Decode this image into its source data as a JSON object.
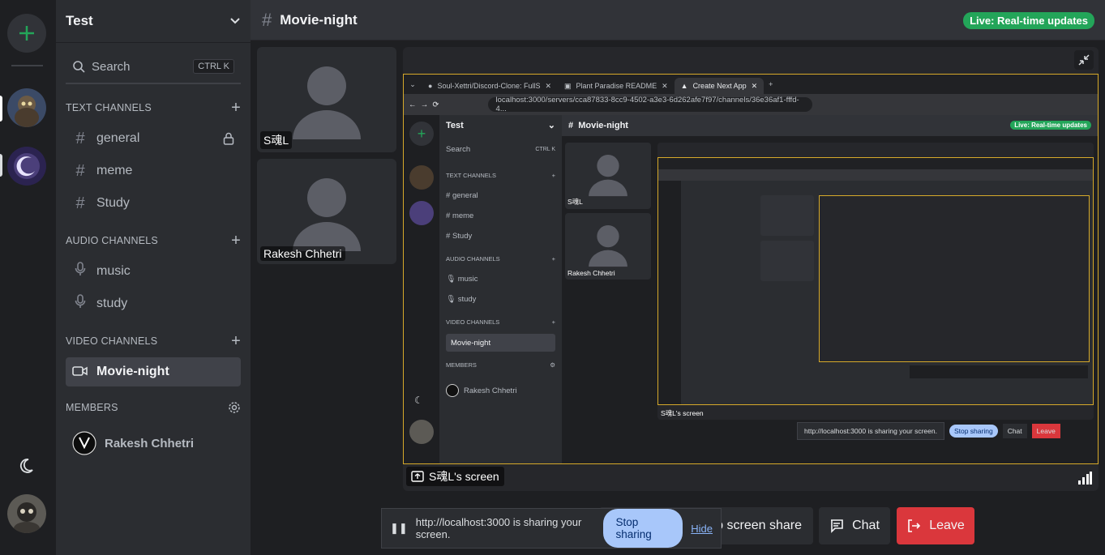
{
  "server": {
    "name": "Test"
  },
  "search": {
    "label": "Search",
    "shortcut": "CTRL K"
  },
  "sections": {
    "text": "TEXT CHANNELS",
    "audio": "AUDIO CHANNELS",
    "video": "VIDEO CHANNELS",
    "members": "MEMBERS"
  },
  "text_channels": [
    "general",
    "meme",
    "Study"
  ],
  "audio_channels": [
    "music",
    "study"
  ],
  "video_channels": [
    "Movie-night"
  ],
  "members": [
    "Rakesh Chhetri"
  ],
  "channel": {
    "title": "Movie-night",
    "live_badge": "Live: Real-time updates"
  },
  "participants": [
    "S魂L",
    "Rakesh Chhetri"
  ],
  "screen_share": {
    "label": "S魂L's screen"
  },
  "browser": {
    "tabs": [
      "Soul-Xettri/Discord-Clone: FullS",
      "Plant Paradise README",
      "Create Next App"
    ],
    "url": "localhost:3000/servers/cca87833-8cc9-4502-a3e3-6d262afe7f97/channels/36e36af1-fffd-4..."
  },
  "controls": {
    "stop_share": "Stop screen share",
    "chat": "Chat",
    "leave": "Leave"
  },
  "share_notice": {
    "text": "http://localhost:3000 is sharing your screen.",
    "stop": "Stop sharing",
    "hide": "Hide"
  },
  "colors": {
    "live": "#23a559",
    "leave": "#da373c",
    "share_border": "#d6a92a",
    "stop_sharing": "#a8c7fa"
  }
}
